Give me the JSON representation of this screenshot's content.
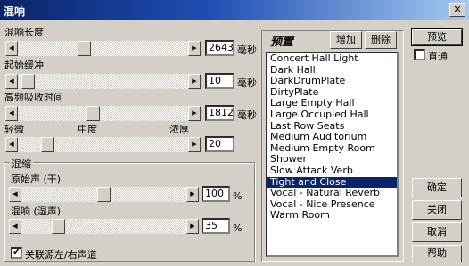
{
  "window": {
    "title": "混响",
    "close_glyph": "✕"
  },
  "reverb_length": {
    "label": "混响长度",
    "value": "2643",
    "unit": "毫秒",
    "level": 0.38
  },
  "attack": {
    "label": "起始缓冲",
    "value": "10",
    "unit": "毫秒",
    "level": 0.02
  },
  "hf_absorb": {
    "label": "高频吸收时间",
    "value": "1812",
    "unit": "毫秒",
    "level": 0.44
  },
  "perception": {
    "low": "轻微",
    "mid": "中度",
    "high": "浓厚",
    "value": "20",
    "level": 0.15
  },
  "mix": {
    "group_label": "混缩",
    "dry": {
      "label": "原始声 (干)",
      "value": "100",
      "unit": "%",
      "level": 0.5
    },
    "wet": {
      "label": "混响 (湿声)",
      "value": "35",
      "unit": "%",
      "level": 0.2
    },
    "link_label": "关联源左/右声道",
    "link_checked": true
  },
  "presets": {
    "title": "预置",
    "add_label": "增加",
    "delete_label": "删除",
    "items": [
      "Concert Hall Light",
      "Dark Hall",
      "DarkDrumPlate",
      "DirtyPlate",
      "Large Empty Hall",
      "Large Occupied Hall",
      "Last Row Seats",
      "Medium Auditorium",
      "Medium Empty Room",
      "Shower",
      "Slow Attack Verb",
      "Tight and Close",
      "Vocal - Natural Reverb",
      "Vocal - Nice Presence",
      "Warm Room"
    ],
    "selected_index": 11
  },
  "buttons": {
    "preview": "预览",
    "bypass": "直通",
    "ok": "确定",
    "close": "关闭",
    "cancel": "取消",
    "help": "帮助"
  },
  "arrows": {
    "left": "◀",
    "right": "▶"
  },
  "checkmark": "✔"
}
